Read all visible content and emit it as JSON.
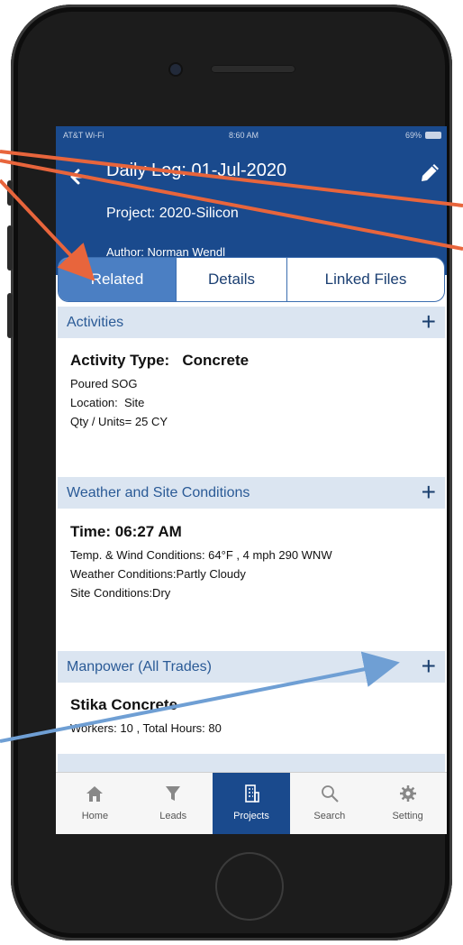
{
  "status_bar": {
    "carrier": "AT&T Wi-Fi",
    "time": "8:60 AM",
    "battery": "69%"
  },
  "header": {
    "title": "Daily Log: 01-Jul-2020",
    "project": "Project: 2020-Silicon",
    "author": "Author: Norman Wendl"
  },
  "tabs": [
    {
      "label": "Related",
      "active": true
    },
    {
      "label": "Details",
      "active": false
    },
    {
      "label": "Linked Files",
      "active": false
    }
  ],
  "sections": {
    "activities": {
      "label": "Activities",
      "entry": {
        "heading": "Activity Type:   Concrete",
        "lines": [
          "Poured SOG",
          "Location:  Site",
          "Qty / Units= 25 CY"
        ]
      }
    },
    "weather": {
      "label": "Weather and Site Conditions",
      "entry": {
        "heading": "Time: 06:27 AM",
        "lines": [
          "Temp. & Wind Conditions: 64°F , 4 mph 290 WNW",
          "Weather Conditions:Partly Cloudy",
          "Site Conditions:Dry"
        ]
      }
    },
    "manpower": {
      "label": "Manpower (All Trades)",
      "entry": {
        "heading": "Stika Concrete",
        "lines": [
          "Workers: 10 , Total Hours: 80"
        ]
      }
    }
  },
  "plus_symbol": "+",
  "tabbar": [
    {
      "label": "Home",
      "icon": "home-icon",
      "active": false
    },
    {
      "label": "Leads",
      "icon": "funnel-icon",
      "active": false
    },
    {
      "label": "Projects",
      "icon": "building-icon",
      "active": true
    },
    {
      "label": "Search",
      "icon": "search-icon",
      "active": false
    },
    {
      "label": "Setting",
      "icon": "gear-icon",
      "active": false
    }
  ],
  "colors": {
    "header_blue": "#1a4a8d",
    "active_tab": "#4b7fc3",
    "section_bg": "#dbe5f1",
    "annotation_orange": "#e8653c",
    "annotation_blue": "#6f9fd4"
  }
}
